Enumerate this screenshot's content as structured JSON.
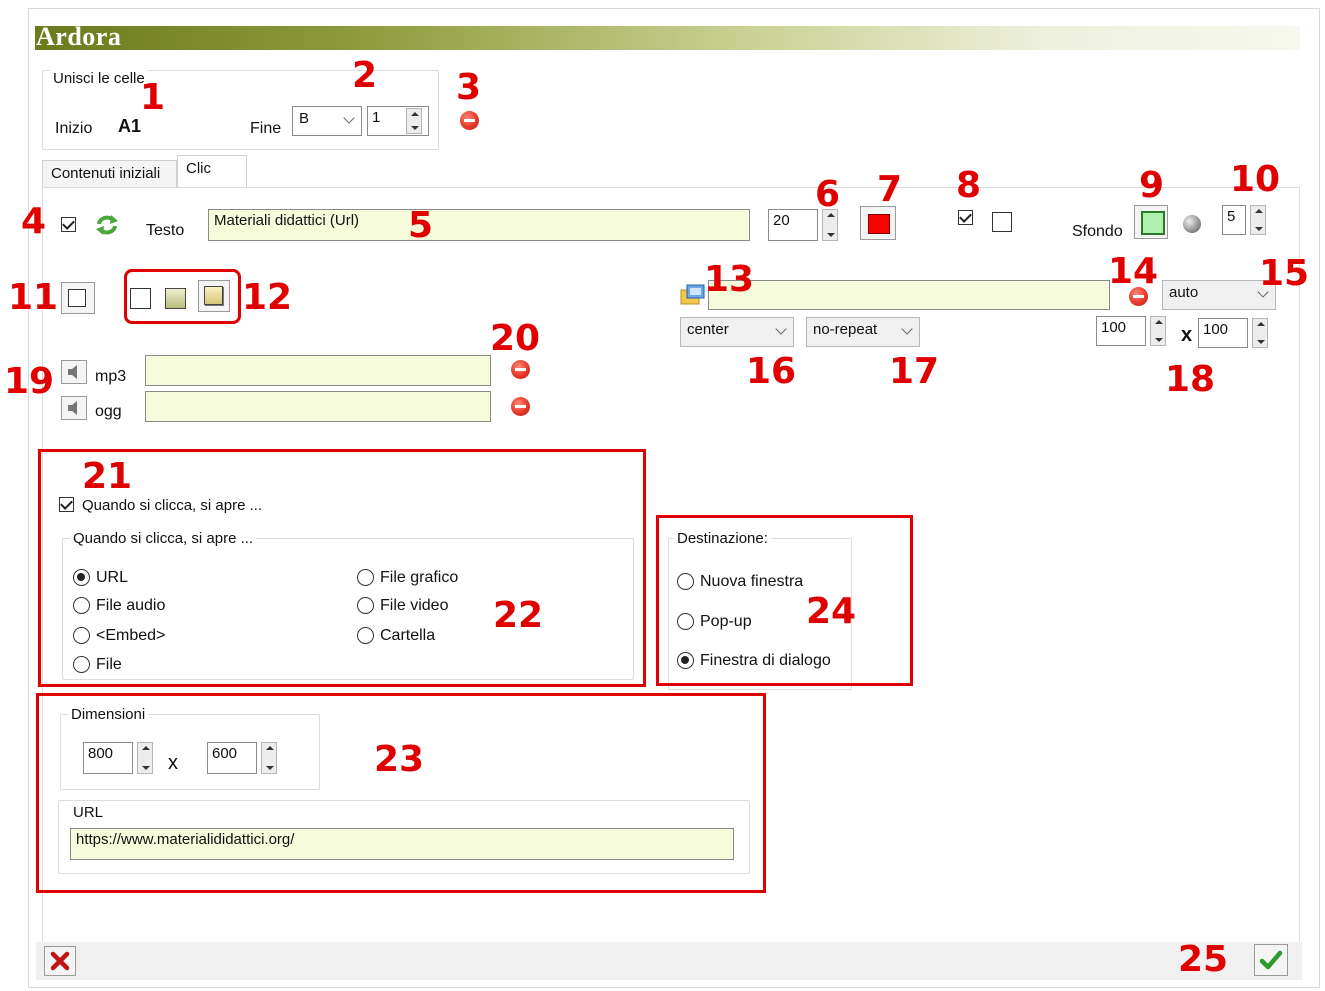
{
  "app": {
    "title": "Ardora"
  },
  "merge": {
    "legend": "Unisci le celle",
    "start_label": "Inizio",
    "start_value": "A1",
    "end_label": "Fine",
    "end_col": "B",
    "end_row": "1"
  },
  "tabs": [
    {
      "label": "Contenuti iniziali"
    },
    {
      "label": "Clic"
    }
  ],
  "text": {
    "label": "Testo",
    "value": "Materiali didattici (Url)",
    "font_size": "20",
    "font_color": "#ff0000"
  },
  "background": {
    "label": "Sfondo",
    "color": "#aef0ae",
    "opacity": "5"
  },
  "image": {
    "path": "",
    "size_mode": "auto",
    "position": "center",
    "repeat": "no-repeat",
    "width": "100",
    "height": "100",
    "times": "x"
  },
  "sound": {
    "mp3_label": "mp3",
    "ogg_label": "ogg",
    "mp3_value": "",
    "ogg_value": ""
  },
  "click": {
    "checkbox_label": "Quando si clicca, si apre ...",
    "group_legend": "Quando si clicca, si apre ...",
    "options": [
      {
        "label": "URL",
        "selected": true
      },
      {
        "label": "File audio",
        "selected": false
      },
      {
        "label": "<Embed>",
        "selected": false
      },
      {
        "label": "File",
        "selected": false
      },
      {
        "label": "File grafico",
        "selected": false
      },
      {
        "label": "File video",
        "selected": false
      },
      {
        "label": "Cartella",
        "selected": false
      }
    ]
  },
  "destination": {
    "legend": "Destinazione:",
    "options": [
      {
        "label": "Nuova finestra",
        "selected": false
      },
      {
        "label": "Pop-up",
        "selected": false
      },
      {
        "label": "Finestra di dialogo",
        "selected": true
      }
    ]
  },
  "dimensions": {
    "legend": "Dimensioni",
    "width": "800",
    "height": "600",
    "times": "x"
  },
  "url": {
    "legend": "URL",
    "value": "https://www.materialididattici.org/"
  },
  "callouts": [
    "1",
    "2",
    "3",
    "4",
    "5",
    "6",
    "7",
    "8",
    "9",
    "10",
    "11",
    "12",
    "13",
    "14",
    "15",
    "16",
    "17",
    "18",
    "19",
    "20",
    "21",
    "22",
    "23",
    "24",
    "25"
  ],
  "colors": {
    "annotation": "#e00000",
    "input_bg": "#f6fbdc",
    "title_bar": "#6b7a1c"
  }
}
